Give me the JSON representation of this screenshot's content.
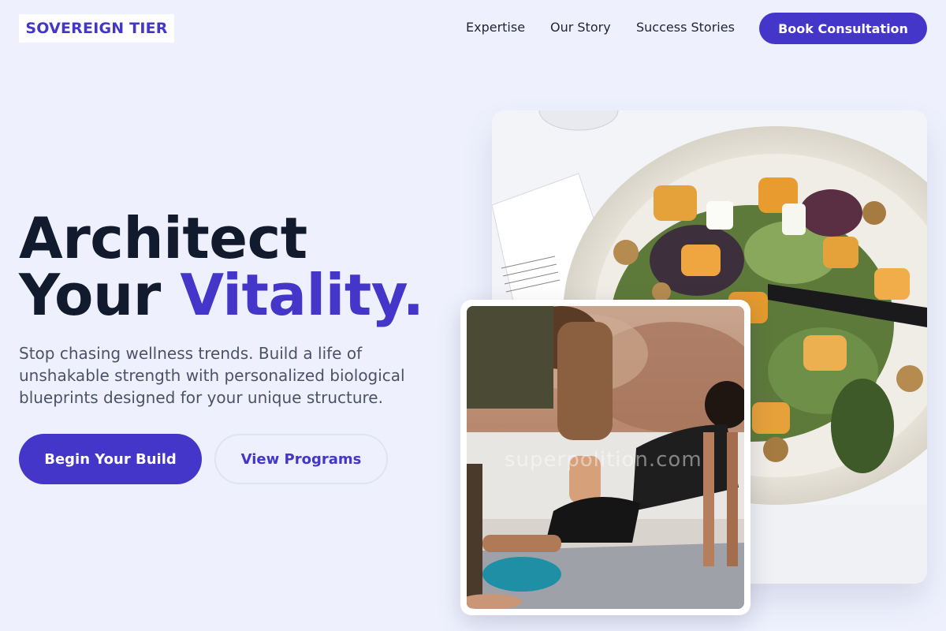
{
  "header": {
    "logo": "SOVEREIGN TIER",
    "nav": [
      "Expertise",
      "Our Story",
      "Success Stories"
    ],
    "cta": "Book Consultation"
  },
  "hero": {
    "headline_line1": "Architect",
    "headline_line2_plain": "Your ",
    "headline_line2_accent": "Vitality.",
    "subtext": "Stop chasing wellness trends. Build a life of unshakable strength with personalized biological blueprints designed for your unique structure.",
    "primary_button": "Begin Your Build",
    "secondary_button": "View Programs"
  },
  "images": {
    "watermark": "superpolition.com"
  },
  "colors": {
    "accent": "#4336c9",
    "background": "#eef1fd",
    "heading": "#121a2e",
    "body_text": "#4a5266"
  }
}
